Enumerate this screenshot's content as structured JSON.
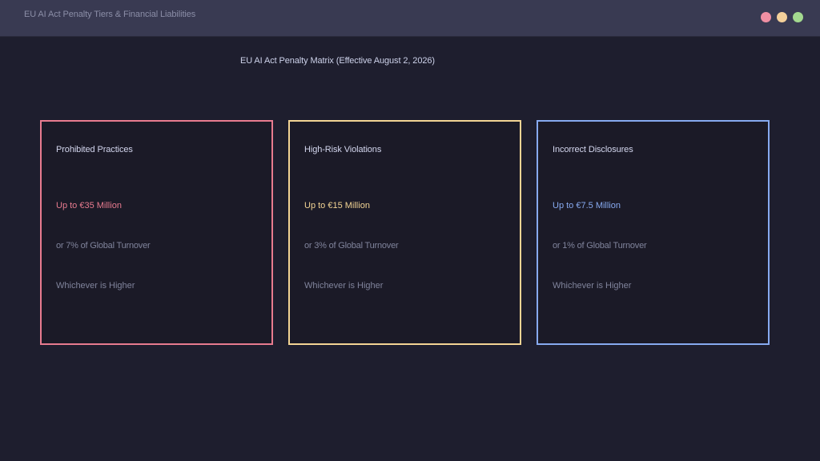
{
  "window": {
    "title": "EU AI Act Penalty Tiers & Financial Liabilities",
    "controls": [
      {
        "name": "close",
        "color": "#f08fa3"
      },
      {
        "name": "minimize",
        "color": "#f4d09a"
      },
      {
        "name": "maximize",
        "color": "#a3d98f"
      }
    ]
  },
  "matrix": {
    "title": "EU AI Act Penalty Matrix (Effective August 2, 2026)"
  },
  "tiers": [
    {
      "name": "Prohibited Practices",
      "amount": "Up to €35 Million",
      "percent": "or 7% of Global Turnover",
      "note": "Whichever is Higher",
      "color": "#e87b8f"
    },
    {
      "name": "High-Risk Violations",
      "amount": "Up to €15 Million",
      "percent": "or 3% of Global Turnover",
      "note": "Whichever is Higher",
      "color": "#f3d494"
    },
    {
      "name": "Incorrect Disclosures",
      "amount": "Up to €7.5 Million",
      "percent": "or 1% of Global Turnover",
      "note": "Whichever is Higher",
      "color": "#87aaf0"
    }
  ]
}
